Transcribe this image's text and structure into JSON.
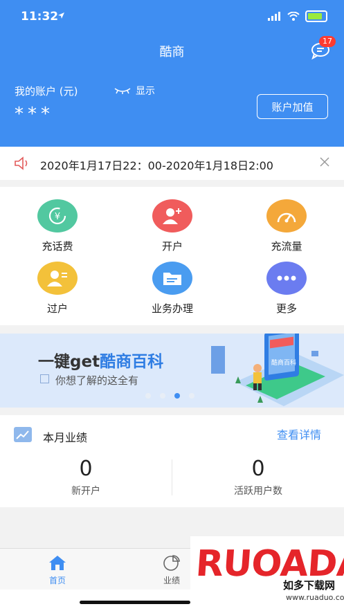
{
  "status_bar": {
    "time": "11:32"
  },
  "header": {
    "title": "酷商",
    "message_badge": "17",
    "account_label": "我的账户 (元)",
    "show_label": "显示",
    "balance": "***",
    "recharge_label": "账户加值",
    "bg_color": "#3f8ef2"
  },
  "notice": {
    "text": "2020年1月17日22：00-2020年1月18日2:00"
  },
  "services": [
    {
      "label": "充话费",
      "icon": "yen-refresh-icon",
      "color": "#52c8a0"
    },
    {
      "label": "开户",
      "icon": "add-user-icon",
      "color": "#f05c5c"
    },
    {
      "label": "充流量",
      "icon": "speedometer-icon",
      "color": "#f4a83a"
    },
    {
      "label": "过户",
      "icon": "transfer-user-icon",
      "color": "#f3c13a"
    },
    {
      "label": "业务办理",
      "icon": "folder-icon",
      "color": "#4a9cf0"
    },
    {
      "label": "更多",
      "icon": "more-dots-icon",
      "color": "#6b7cf0"
    }
  ],
  "banner": {
    "title_prefix": "一键get",
    "title_highlight": "酷商百科",
    "subtitle": "你想了解的这全有",
    "sign_text": "酷商百科"
  },
  "performance": {
    "title": "本月业绩",
    "details_link": "查看详情",
    "stats": [
      {
        "value": "0",
        "label": "新开户"
      },
      {
        "value": "0",
        "label": "活跃用户数"
      }
    ]
  },
  "tabs": [
    {
      "label": "首页",
      "icon": "home-icon",
      "active": true
    },
    {
      "label": "业绩",
      "icon": "pie-chart-icon",
      "active": false
    }
  ],
  "watermark": {
    "brand": "RUOADAO",
    "sub": "如多下载网",
    "url": "www.ruaduo.com"
  }
}
